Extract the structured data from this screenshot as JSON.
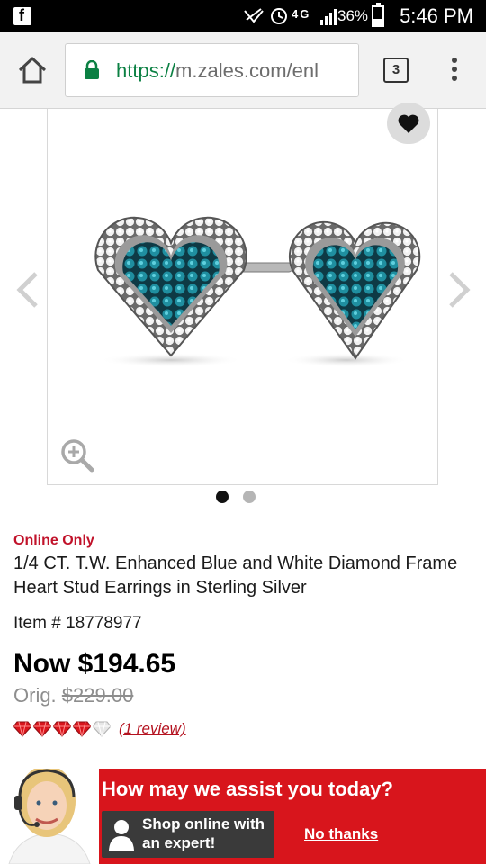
{
  "status_bar": {
    "app_icon": "facebook-icon",
    "network": "4G",
    "battery_percent": "36%",
    "battery_level": 0.36,
    "time": "5:46 PM"
  },
  "browser": {
    "url_protocol": "https://",
    "url_rest": "m.zales.com/enl",
    "tab_count": "3",
    "icons": [
      "home-icon",
      "lock-icon",
      "tabs-icon",
      "menu-icon"
    ]
  },
  "product": {
    "badge": "Online Only",
    "title": "1/4 CT. T.W. Enhanced Blue and White Diamond Frame Heart Stud Earrings in Sterling Silver",
    "item_number": "Item # 18778977",
    "price_now": "Now $194.65",
    "price_orig_label": "Orig.",
    "price_orig_value": "$229.00",
    "rating": 4,
    "rating_max": 5,
    "review_link": "(1 review)",
    "image_count": 2,
    "image_active": 1
  },
  "chat_banner": {
    "title": "How may we assist you today?",
    "expert_button": "Shop online with an expert!",
    "expert_line1": "Shop online with",
    "expert_line2": "an expert!",
    "dismiss": "No thanks"
  },
  "colors": {
    "brand_red": "#d8151c",
    "online_only": "#c1122a",
    "url_green": "#0b8043"
  }
}
